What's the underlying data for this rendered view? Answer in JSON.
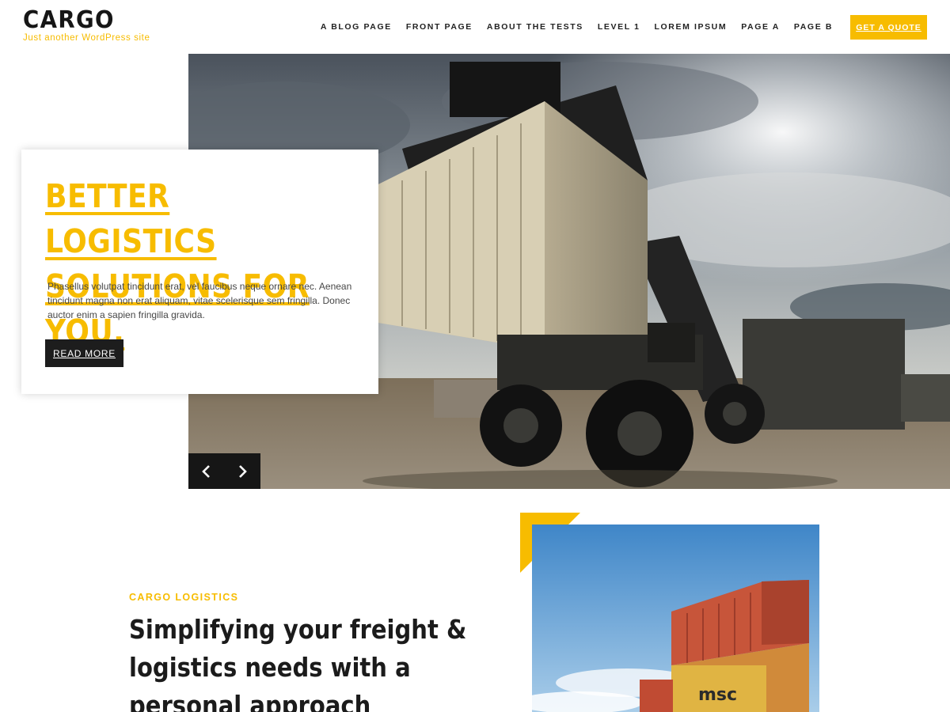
{
  "site": {
    "title": "CARGO",
    "tagline": "Just another WordPress site"
  },
  "nav": {
    "items": [
      {
        "label": "A BLOG PAGE",
        "name": "nav-item-blog-page"
      },
      {
        "label": "FRONT PAGE",
        "name": "nav-item-front-page"
      },
      {
        "label": "ABOUT THE TESTS",
        "name": "nav-item-about-the-tests"
      },
      {
        "label": "LEVEL 1",
        "name": "nav-item-level-1"
      },
      {
        "label": "LOREM IPSUM",
        "name": "nav-item-lorem-ipsum"
      },
      {
        "label": "PAGE A",
        "name": "nav-item-page-a"
      },
      {
        "label": "PAGE B",
        "name": "nav-item-page-b"
      }
    ],
    "cta_label": "GET A QUOTE"
  },
  "hero": {
    "heading_line1": "BETTER LOGISTICS",
    "heading_line2": "SOLUTIONS FOR YOU.",
    "text": "Phasellus volutpat tincidunt erat, vel faucibus neque ornare nec. Aenean tincidunt magna non erat aliquam, vitae scelerisque sem fringilla. Donec auctor enim a sapien fringilla gravida.",
    "button_label": "READ MORE",
    "prev_icon": "chevron-left-icon",
    "next_icon": "chevron-right-icon"
  },
  "section": {
    "eyebrow": "CARGO LOGISTICS",
    "heading": "Simplifying your freight & logistics needs with a personal approach"
  },
  "colors": {
    "accent": "#f7bc00",
    "dark": "#1d1d1d",
    "text": "#474747"
  }
}
